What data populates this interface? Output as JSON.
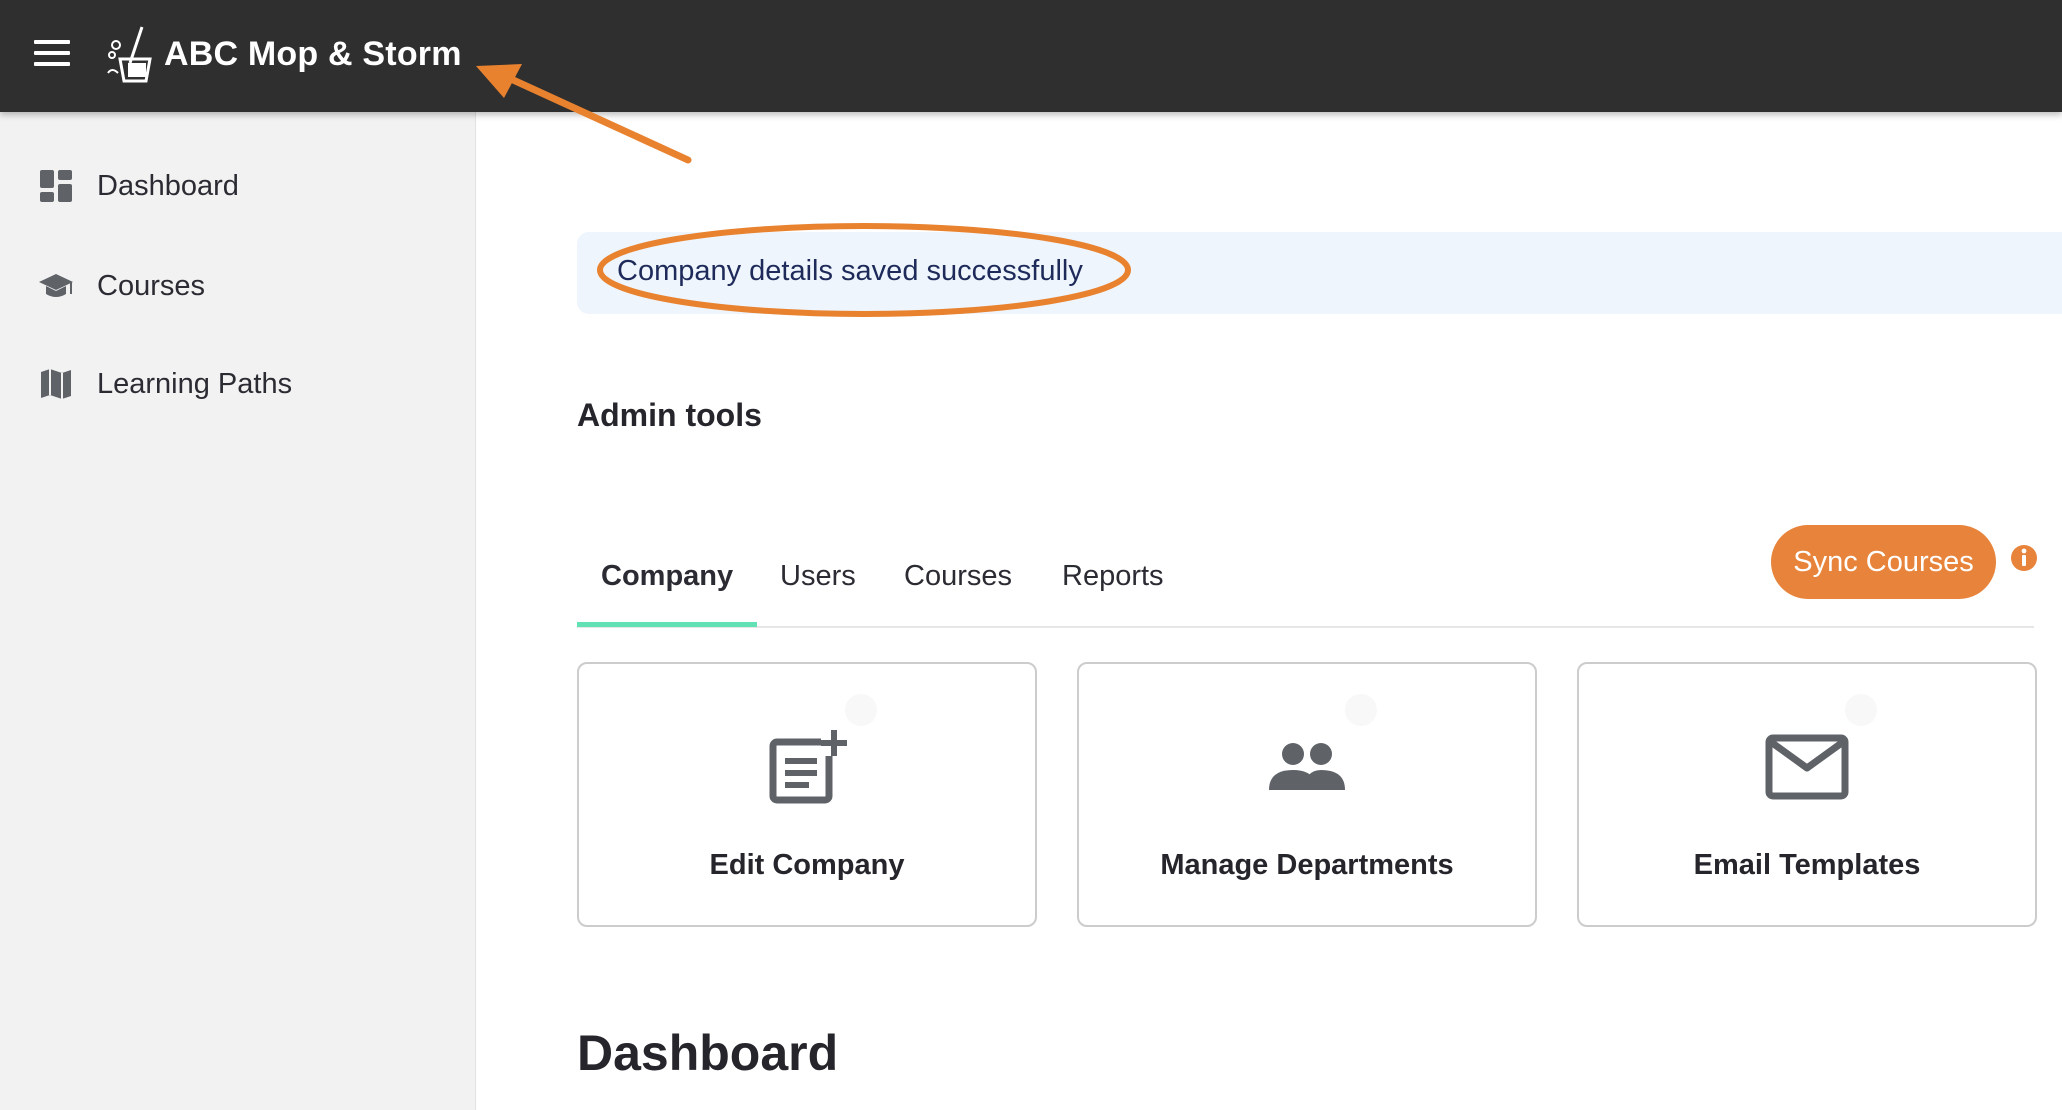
{
  "header": {
    "app_name": "ABC Mop & Storm",
    "menu_icon": "hamburger-menu-icon",
    "logo_icon": "mop-bucket-cloud-logo"
  },
  "sidebar": {
    "items": [
      {
        "label": "Dashboard",
        "icon": "dashboard-grid-icon"
      },
      {
        "label": "Courses",
        "icon": "graduation-cap-icon"
      },
      {
        "label": "Learning Paths",
        "icon": "map-icon"
      }
    ]
  },
  "alert": {
    "message": "Company details saved successfully"
  },
  "admin": {
    "title": "Admin tools",
    "tabs": [
      {
        "label": "Company",
        "active": true
      },
      {
        "label": "Users",
        "active": false
      },
      {
        "label": "Courses",
        "active": false
      },
      {
        "label": "Reports",
        "active": false
      }
    ],
    "sync_button": "Sync Courses",
    "info_icon": "info-circle-icon",
    "cards": [
      {
        "label": "Edit Company",
        "icon": "post-add-icon"
      },
      {
        "label": "Manage Departments",
        "icon": "people-icon"
      },
      {
        "label": "Email Templates",
        "icon": "envelope-icon"
      }
    ]
  },
  "dashboard": {
    "heading": "Dashboard"
  },
  "colors": {
    "topbar": "#2f2f2f",
    "sidebar": "#f2f2f2",
    "accent_orange": "#e7833a",
    "tab_underline": "#62e2b4",
    "alert_bg": "#eef5fc",
    "annotation": "#e9822f"
  }
}
